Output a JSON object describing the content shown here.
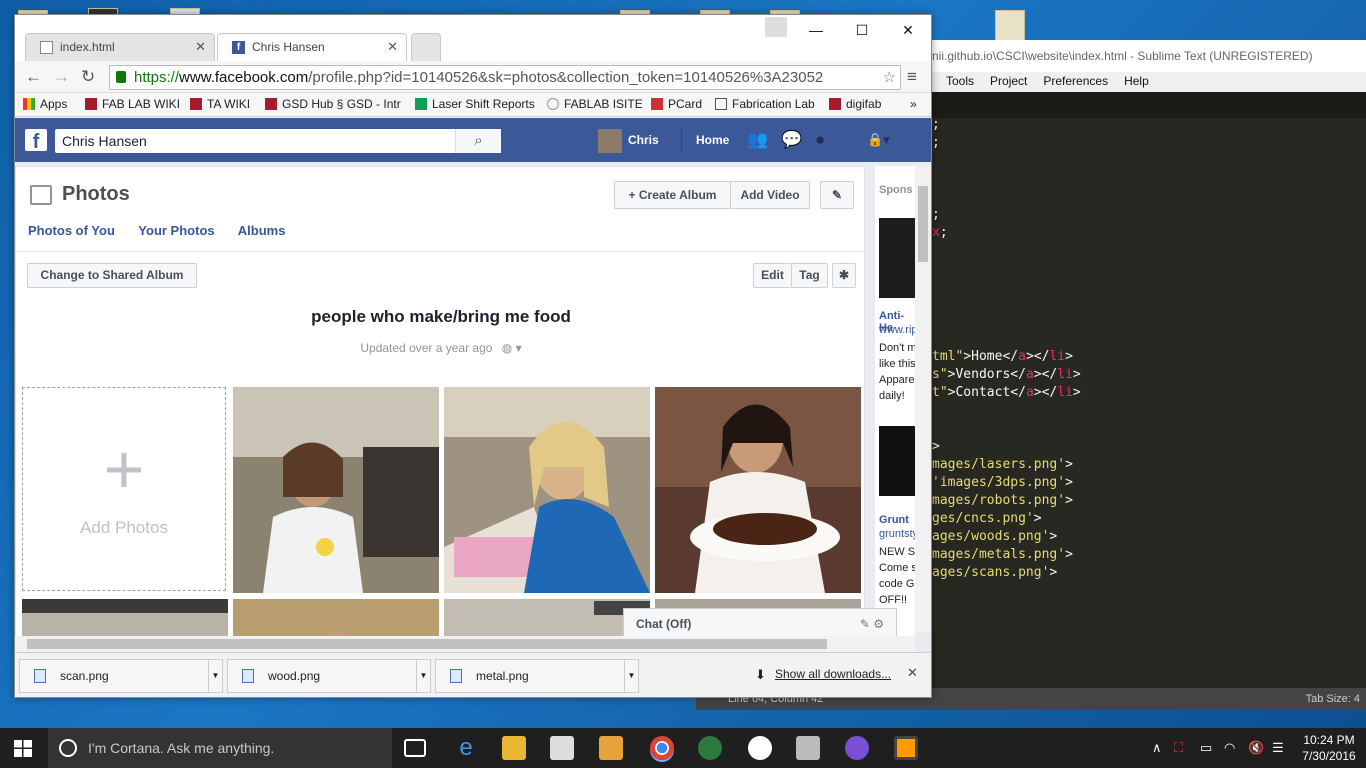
{
  "browser": {
    "tabs": [
      {
        "label": "index.html",
        "active": false
      },
      {
        "label": "Chris Hansen",
        "active": true
      }
    ],
    "url_secure": "https://",
    "url_host": "www.facebook.com",
    "url_rest": "/profile.php?id=10140526&sk=photos&collection_token=10140526%3A23052",
    "bookmarks": [
      "Apps",
      "FAB LAB WIKI",
      "TA WIKI",
      "GSD Hub § GSD - Intr",
      "Laser Shift Reports",
      "FABLAB ISITE",
      "PCard",
      "Fabrication Lab",
      "digifab"
    ],
    "bookmarks_more": "»"
  },
  "facebook": {
    "search_value": "Chris Hansen",
    "user_name": "Chris",
    "home_label": "Home",
    "section_title": "Photos",
    "create_album": "+ Create Album",
    "add_video": "Add Video",
    "tabs": [
      "Photos of You",
      "Your Photos",
      "Albums"
    ],
    "change_shared": "Change to Shared Album",
    "edit": "Edit",
    "tag": "Tag",
    "album_title": "people who make/bring me food",
    "album_updated": "Updated over a year ago",
    "add_photos": "Add Photos",
    "sponsored_label": "Spons",
    "ads": [
      {
        "title": "Anti-He",
        "url": "www.rip",
        "text": [
          "Don't m",
          "like this",
          "Appare",
          "daily!"
        ]
      },
      {
        "title": "Grunt",
        "url": "gruntsty",
        "text": [
          "NEW S",
          "Come s",
          "code G",
          "OFF!!"
        ]
      }
    ],
    "chat_label": "Chat (Off)"
  },
  "downloads": {
    "items": [
      "scan.png",
      "wood.png",
      "metal.png"
    ],
    "show_all": "Show all downloads..."
  },
  "sublime": {
    "title": "nii.github.io\\CSCI\\website\\index.html - Sublime Text (UNREGISTERED)",
    "menu": [
      "Tools",
      "Project",
      "Preferences",
      "Help"
    ],
    "status_left": "Line 64, Column 42",
    "status_right": "Tab Size: 4"
  },
  "taskbar": {
    "cortana_placeholder": "I'm Cortana. Ask me anything.",
    "time": "10:24 PM",
    "date": "7/30/2016"
  },
  "colors": {
    "facebook_blue": "#3b5998",
    "link_blue": "#365899",
    "sublime_bg": "#272822",
    "taskbar": "#1f1f1f"
  }
}
